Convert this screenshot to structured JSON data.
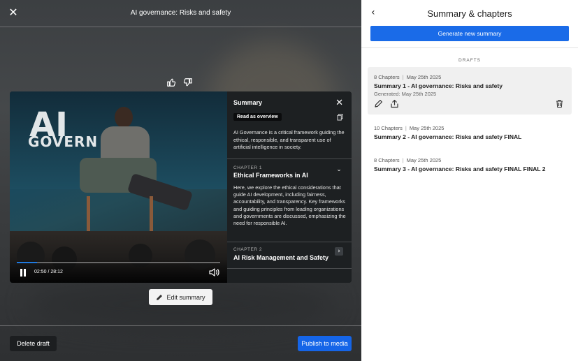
{
  "left": {
    "close_icon": "close-icon",
    "title": "AI governance: Risks and safety",
    "feedback": {
      "like_icon": "thumbs-up-icon",
      "dislike_icon": "thumbs-down-icon"
    },
    "video": {
      "brand_line1": "AI",
      "brand_line2": "GOVERN",
      "time": "02:50 / 28:12",
      "progress": 0.1,
      "play_state_icon": "pause-icon",
      "volume_icon": "volume-icon"
    },
    "summary_panel": {
      "title": "Summary",
      "read_as_overview": "Read as overview",
      "description": "AI Governance is a critical framework guiding the ethical, responsible, and transparent use of artificial intelligence in society.",
      "chapters": [
        {
          "label": "CHAPTER 1",
          "title": "Ethical Frameworks in AI",
          "expanded": true,
          "body": "Here, we explore the ethical considerations that guide AI development, including fairness, accountability, and transparency. Key frameworks and guiding principles from leading organizations and governments are discussed, emphasizing the need for responsible AI."
        },
        {
          "label": "CHAPTER 2",
          "title": "AI Risk Management and Safety",
          "expanded": false,
          "body": ""
        }
      ]
    },
    "edit_summary": "Edit summary",
    "delete_draft": "Delete draft",
    "publish": "Publish to media"
  },
  "right": {
    "title": "Summary & chapters",
    "generate": "Generate new summary",
    "drafts_label": "DRAFTS",
    "drafts": [
      {
        "chapters": "8 Chapters",
        "date": "May 25th 2025",
        "title": "Summary 1 - AI governance: Risks and safety",
        "generated": "Generated: May 25th 2025",
        "selected": true
      },
      {
        "chapters": "10 Chapters",
        "date": "May 25th 2025",
        "title": "Summary 2 - AI governance: Risks and safety FINAL",
        "selected": false
      },
      {
        "chapters": "8 Chapters",
        "date": "May 25th 2025",
        "title": "Summary 3 - AI governance: Risks and safety FINAL FINAL 2",
        "selected": false
      }
    ]
  },
  "colors": {
    "primary": "#1a6be8",
    "panel_dark": "#1e2124",
    "selected_row": "#f0f0f0"
  }
}
